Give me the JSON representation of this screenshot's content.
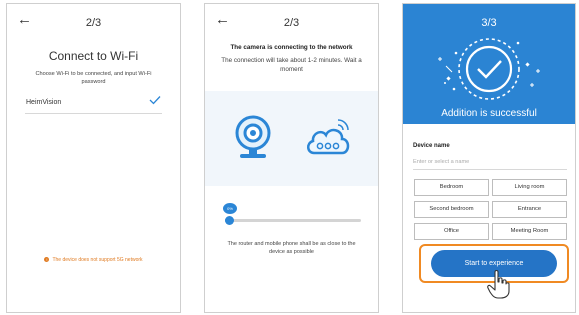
{
  "step1": {
    "back_glyph": "←",
    "step": "2/3",
    "title": "Connect to Wi-Fi",
    "description": "Choose Wi-Fi to be connected, and input Wi-Fi password",
    "network_name": "HeimVision",
    "warning": "The device does not support 5G network",
    "icons": [
      "back-arrow-icon",
      "checkmark-icon",
      "warning-icon"
    ],
    "colors": {
      "accent": "#2b86d6",
      "warning": "#e07b22"
    }
  },
  "step2": {
    "back_glyph": "←",
    "step": "2/3",
    "title": "The camera is connecting to the network",
    "description": "The connection will take about 1-2 minutes. Wait a moment",
    "progress_label": "0%",
    "progress_fraction": 0.03,
    "footer": "The router and mobile phone shall be as close to the device as possible",
    "icons": [
      "back-arrow-icon",
      "camera-icon",
      "cloud-wifi-icon"
    ]
  },
  "step3": {
    "step": "3/3",
    "title": "Addition is successful",
    "device_name_label": "Device name",
    "device_name_placeholder": "Enter or select a name",
    "options": [
      "Bedroom",
      "Living room",
      "Second bedroom",
      "Entrance",
      "Office",
      "Meeting Room"
    ],
    "cta": "Start to experience",
    "icons": [
      "success-check-icon",
      "tap-hand-icon"
    ],
    "colors": {
      "hero": "#2b84d3",
      "cta": "#2574c6",
      "highlight": "#f08a23"
    }
  }
}
